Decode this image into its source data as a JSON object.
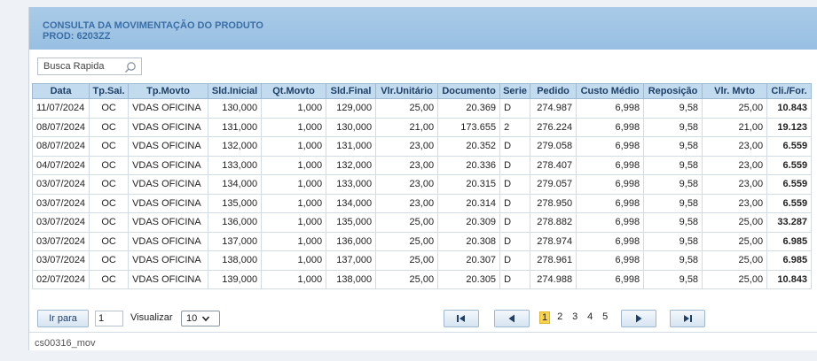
{
  "header": {
    "title": "CONSULTA DA MOVIMENTAÇÃO DO PRODUTO",
    "product": "PROD: 6203ZZ"
  },
  "search": {
    "label": "Busca Rapida"
  },
  "table": {
    "columns": [
      "Data",
      "Tp.Sai.",
      "Tp.Movto",
      "Sld.Inicial",
      "Qt.Movto",
      "Sld.Final",
      "Vlr.Unitário",
      "Documento",
      "Serie",
      "Pedido",
      "Custo Médio",
      "Reposição",
      "Vlr. Mvto",
      "Cli./For."
    ],
    "rows": [
      [
        "11/07/2024",
        "OC",
        "VDAS OFICINA",
        "130,000",
        "1,000",
        "129,000",
        "25,00",
        "20.369",
        "D",
        "274.987",
        "6,998",
        "9,58",
        "25,00",
        "10.843"
      ],
      [
        "08/07/2024",
        "OC",
        "VDAS OFICINA",
        "131,000",
        "1,000",
        "130,000",
        "21,00",
        "173.655",
        "2",
        "276.224",
        "6,998",
        "9,58",
        "21,00",
        "19.123"
      ],
      [
        "08/07/2024",
        "OC",
        "VDAS OFICINA",
        "132,000",
        "1,000",
        "131,000",
        "23,00",
        "20.352",
        "D",
        "279.058",
        "6,998",
        "9,58",
        "23,00",
        "6.559"
      ],
      [
        "04/07/2024",
        "OC",
        "VDAS OFICINA",
        "133,000",
        "1,000",
        "132,000",
        "23,00",
        "20.336",
        "D",
        "278.407",
        "6,998",
        "9,58",
        "23,00",
        "6.559"
      ],
      [
        "03/07/2024",
        "OC",
        "VDAS OFICINA",
        "134,000",
        "1,000",
        "133,000",
        "23,00",
        "20.315",
        "D",
        "279.057",
        "6,998",
        "9,58",
        "23,00",
        "6.559"
      ],
      [
        "03/07/2024",
        "OC",
        "VDAS OFICINA",
        "135,000",
        "1,000",
        "134,000",
        "23,00",
        "20.314",
        "D",
        "278.950",
        "6,998",
        "9,58",
        "23,00",
        "6.559"
      ],
      [
        "03/07/2024",
        "OC",
        "VDAS OFICINA",
        "136,000",
        "1,000",
        "135,000",
        "25,00",
        "20.309",
        "D",
        "278.882",
        "6,998",
        "9,58",
        "25,00",
        "33.287"
      ],
      [
        "03/07/2024",
        "OC",
        "VDAS OFICINA",
        "137,000",
        "1,000",
        "136,000",
        "25,00",
        "20.308",
        "D",
        "278.974",
        "6,998",
        "9,58",
        "25,00",
        "6.985"
      ],
      [
        "03/07/2024",
        "OC",
        "VDAS OFICINA",
        "138,000",
        "1,000",
        "137,000",
        "25,00",
        "20.307",
        "D",
        "278.961",
        "6,998",
        "9,58",
        "25,00",
        "6.985"
      ],
      [
        "02/07/2024",
        "OC",
        "VDAS OFICINA",
        "139,000",
        "1,000",
        "138,000",
        "25,00",
        "20.305",
        "D",
        "274.988",
        "6,998",
        "9,58",
        "25,00",
        "10.843"
      ]
    ]
  },
  "pager": {
    "goto_label": "Ir para",
    "goto_value": "1",
    "view_label": "Visualizar",
    "page_size": "10",
    "pages": [
      "1",
      "2",
      "3",
      "4",
      "5"
    ],
    "current_page": "1"
  },
  "footer": {
    "screen_id": "cs00316_mov"
  },
  "colors": {
    "header_bg": "#a9cbe8",
    "title_text": "#3a6ea5",
    "accent_red": "#c1272d",
    "current_page": "#f9d34e"
  }
}
